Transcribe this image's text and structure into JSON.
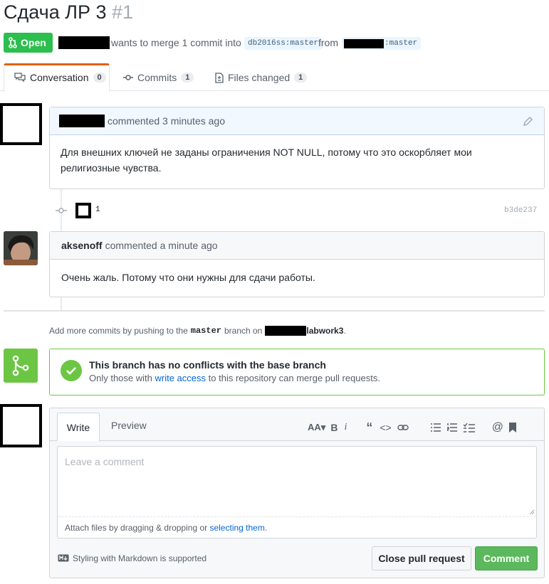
{
  "header": {
    "title": "Сдача ЛР 3",
    "number": "#1",
    "status_label": "Open",
    "merge_text": "wants to merge 1 commit into",
    "base_branch": "db2016ss:master",
    "from_text": "from",
    "head_branch_suffix": ":master"
  },
  "tabs": [
    {
      "label": "Conversation",
      "count": "0"
    },
    {
      "label": "Commits",
      "count": "1"
    },
    {
      "label": "Files changed",
      "count": "1"
    }
  ],
  "comment1": {
    "action": "commented 3 minutes ago",
    "body": "Для внешних ключей не заданы ограничения NOT NULL, потому что это оскорбляет мои религиозные чувства."
  },
  "commit": {
    "message": "1",
    "sha": "b3de237"
  },
  "comment2": {
    "author": "aksenoff",
    "action": "commented a minute ago",
    "body": "Очень жаль. Потому что они нужны для сдачи работы."
  },
  "push_hint": {
    "prefix": "Add more commits by pushing to the",
    "branch": "master",
    "mid": "branch on",
    "repo": "labwork3",
    "suffix": "."
  },
  "merge": {
    "title": "This branch has no conflicts with the base branch",
    "desc_prefix": "Only those with",
    "desc_link": "write access",
    "desc_suffix": "to this repository can merge pull requests."
  },
  "composer": {
    "tab_write": "Write",
    "tab_preview": "Preview",
    "placeholder": "Leave a comment",
    "attach_prefix": "Attach files by dragging & dropping or",
    "attach_link": "selecting them",
    "attach_suffix": ".",
    "markdown_note": "Styling with Markdown is supported",
    "close_button": "Close pull request",
    "comment_button": "Comment",
    "toolbar": [
      "header-icon",
      "bold-icon",
      "italic-icon",
      "quote-icon",
      "code-icon",
      "link-icon",
      "bullet-list-icon",
      "numbered-list-icon",
      "task-list-icon",
      "mention-icon",
      "saved-reply-icon"
    ]
  },
  "colors": {
    "green": "#2cbe4e",
    "merge_green": "#6cc644",
    "link_blue": "#0366d6",
    "tab_orange": "#e36209"
  }
}
